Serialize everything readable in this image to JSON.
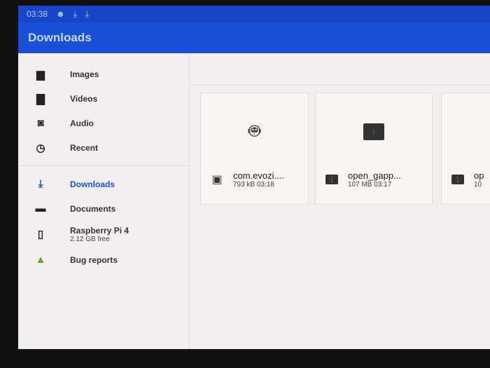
{
  "status": {
    "time": "03:38"
  },
  "appbar": {
    "title": "Downloads"
  },
  "sidebar": {
    "items": [
      {
        "label": "Images",
        "icon": "image-icon"
      },
      {
        "label": "Videos",
        "icon": "video-icon"
      },
      {
        "label": "Audio",
        "icon": "audio-icon"
      },
      {
        "label": "Recent",
        "icon": "clock-icon"
      },
      {
        "label": "Downloads",
        "icon": "download-icon"
      },
      {
        "label": "Documents",
        "icon": "folder-icon"
      },
      {
        "label": "Raspberry Pi 4",
        "sub": "2.12 GB free",
        "icon": "device-icon"
      },
      {
        "label": "Bug reports",
        "icon": "android-icon"
      }
    ]
  },
  "files": [
    {
      "name": "com.evozi....",
      "meta": "793 kB 03:18",
      "type": "apk"
    },
    {
      "name": "open_gapp...",
      "meta": "107 MB 03:17",
      "type": "zip"
    },
    {
      "name": "op",
      "meta": "10",
      "type": "zip"
    }
  ],
  "colors": {
    "accent": "#1a50d8"
  }
}
